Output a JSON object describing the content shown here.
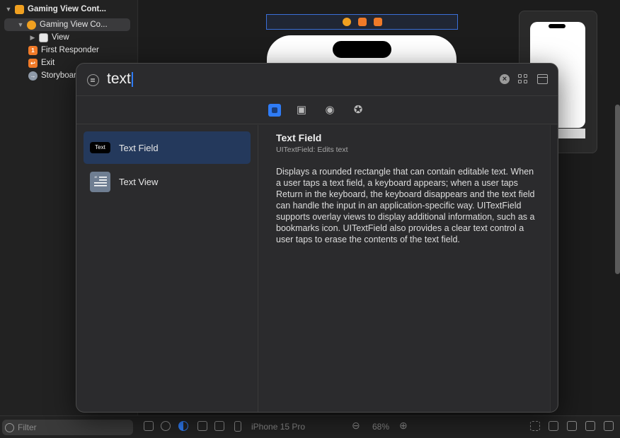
{
  "outline": {
    "items": [
      {
        "label": "Gaming View Cont..."
      },
      {
        "label": "Gaming View Co..."
      },
      {
        "label": "View"
      },
      {
        "label": "First Responder"
      },
      {
        "label": "Exit"
      },
      {
        "label": "Storyboar"
      }
    ]
  },
  "library": {
    "search_value": "text",
    "tabs": [
      {
        "icon": "objects-icon"
      },
      {
        "icon": "image-icon"
      },
      {
        "icon": "palette-icon"
      },
      {
        "icon": "star-icon"
      }
    ],
    "results": [
      {
        "label": "Text Field",
        "thumb_text": "Text"
      },
      {
        "label": "Text View"
      }
    ],
    "detail": {
      "title": "Text Field",
      "subtitle": "UITextField: Edits text",
      "description": "Displays a rounded rectangle that can contain editable text. When a user taps a text field, a keyboard appears; when a user taps Return in the keyboard, the keyboard disappears and the text field can handle the input in an application-specific way. UITextField supports overlay views to display additional information, such as a bookmarks icon. UITextField also provides a clear text control a user taps to erase the contents of the text field."
    }
  },
  "bottombar": {
    "filter_placeholder": "Filter",
    "device": "iPhone 15 Pro",
    "zoom": "68%"
  },
  "colors": {
    "accent": "#2f7cf6",
    "selection": "#24395c"
  }
}
